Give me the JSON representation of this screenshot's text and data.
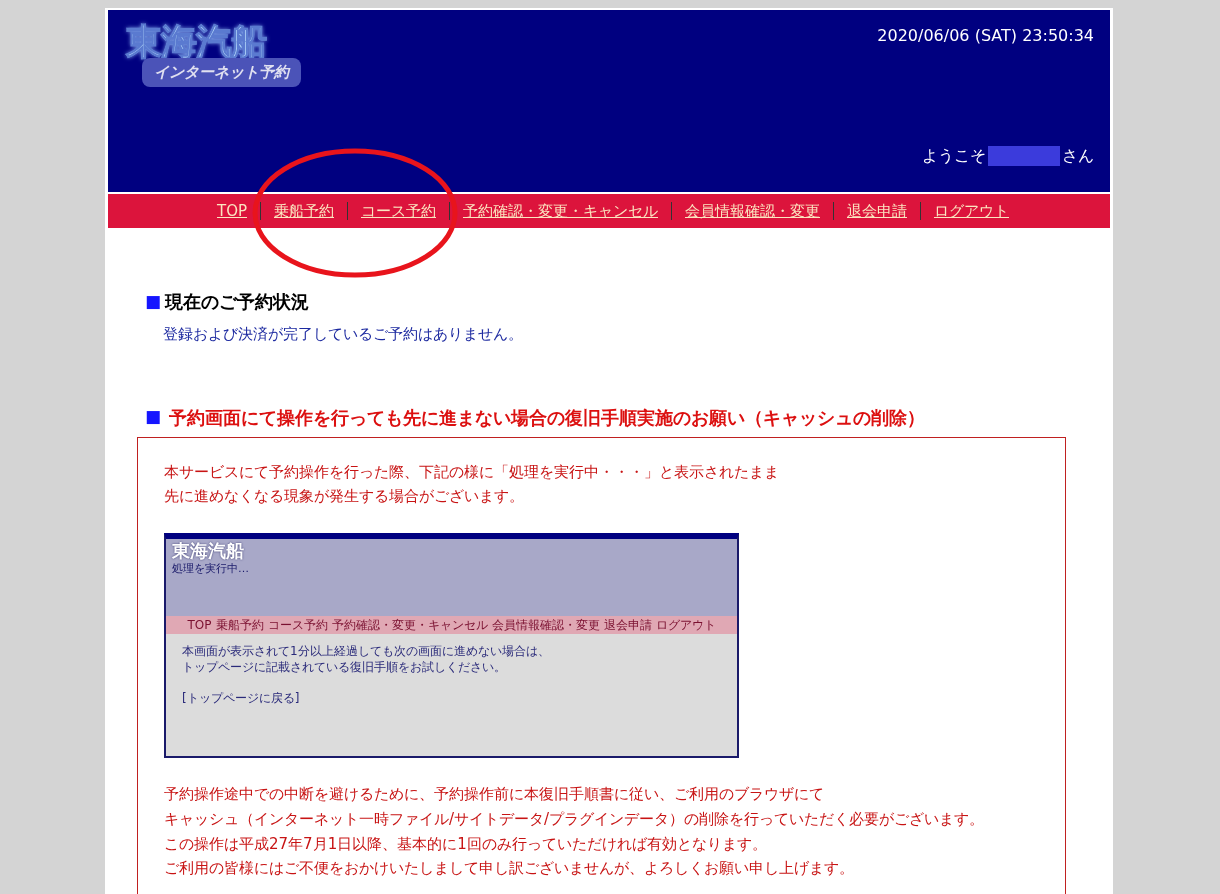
{
  "header": {
    "logo": {
      "title": "東海汽船",
      "subtitle": "インターネット予約"
    },
    "datetime": "2020/06/06 (SAT) 23:50:34",
    "welcome": {
      "prefix": "ようこそ",
      "suffix": "さん"
    }
  },
  "nav": [
    {
      "label": "TOP"
    },
    {
      "label": "乗船予約"
    },
    {
      "label": "コース予約"
    },
    {
      "label": "予約確認・変更・キャンセル"
    },
    {
      "label": "会員情報確認・変更"
    },
    {
      "label": "退会申請"
    },
    {
      "label": "ログアウト"
    }
  ],
  "annotation": {
    "kind": "ellipse",
    "color": "#e8141c"
  },
  "reservations": {
    "marker": "■",
    "heading": "現在のご予約状況",
    "message": "登録および決済が完了しているご予約はありません。"
  },
  "notice": {
    "marker": "■",
    "heading": "予約画面にて操作を行っても先に進まない場合の復旧手順実施のお願い（キャッシュの削除）",
    "intro": [
      "本サービスにて予約操作を行った際、下記の様に「処理を実行中・・・」と表示されたまま",
      "先に進めなくなる現象が発生する場合がございます。"
    ],
    "example": {
      "logo": "東海汽船",
      "status": "処理を実行中…",
      "nav": [
        "TOP",
        "乗船予約",
        "コース予約",
        "予約確認・変更・キャンセル",
        "会員情報確認・変更",
        "退会申請",
        "ログアウト"
      ],
      "message": [
        "本画面が表示されて1分以上経過しても次の画面に進めない場合は、",
        "トップページに記載されている復旧手順をお試しください。"
      ],
      "link": "[トップページに戻る]"
    },
    "body": [
      "予約操作途中での中断を避けるために、予約操作前に本復旧手順書に従い、ご利用のブラウザにて",
      "キャッシュ（インターネット一時ファイル/サイトデータ/プラグインデータ）の削除を行っていただく必要がございます。",
      "この操作は平成27年7月1日以降、基本的に1回のみ行っていただければ有効となります。",
      "ご利用の皆様にはご不便をおかけいたしまして申し訳ございませんが、よろしくお願い申し上げます。"
    ]
  }
}
